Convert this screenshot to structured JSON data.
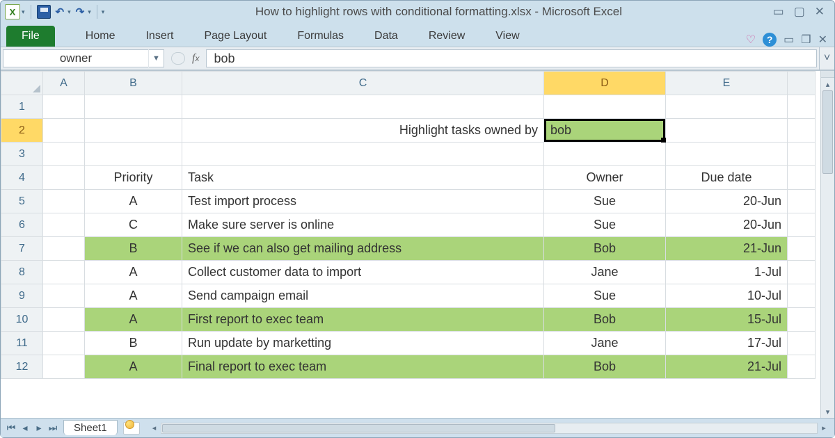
{
  "title": "How to highlight rows with conditional formatting.xlsx - Microsoft Excel",
  "tabs": {
    "file": "File",
    "home": "Home",
    "insert": "Insert",
    "page": "Page Layout",
    "formulas": "Formulas",
    "data": "Data",
    "review": "Review",
    "view": "View"
  },
  "namebox": "owner",
  "formula": "bob",
  "columns": [
    "A",
    "B",
    "C",
    "D",
    "E"
  ],
  "prompt_label": "Highlight tasks owned by",
  "prompt_value": "bob",
  "headers": {
    "priority": "Priority",
    "task": "Task",
    "owner": "Owner",
    "due": "Due date"
  },
  "rows": [
    {
      "p": "A",
      "t": "Test import process",
      "o": "Sue",
      "d": "20-Jun",
      "hl": false
    },
    {
      "p": "C",
      "t": "Make sure server is online",
      "o": "Sue",
      "d": "20-Jun",
      "hl": false
    },
    {
      "p": "B",
      "t": "See if we can also get mailing address",
      "o": "Bob",
      "d": "21-Jun",
      "hl": true
    },
    {
      "p": "A",
      "t": "Collect customer data to import",
      "o": "Jane",
      "d": "1-Jul",
      "hl": false
    },
    {
      "p": "A",
      "t": "Send campaign email",
      "o": "Sue",
      "d": "10-Jul",
      "hl": false
    },
    {
      "p": "A",
      "t": "First report to exec team",
      "o": "Bob",
      "d": "15-Jul",
      "hl": true
    },
    {
      "p": "B",
      "t": "Run update by marketting",
      "o": "Jane",
      "d": "17-Jul",
      "hl": false
    },
    {
      "p": "A",
      "t": "Final report to exec team",
      "o": "Bob",
      "d": "21-Jul",
      "hl": true
    }
  ],
  "sheet_tab": "Sheet1",
  "glyph": {
    "heart": "♡",
    "min": "▭",
    "max": "▢",
    "close": "✕",
    "down": "▾",
    "up": "▴",
    "left": "◂",
    "right": "▸",
    "first": "⏮",
    "last": "⏭",
    "undo": "↶",
    "redo": "↷",
    "sep": "▾"
  }
}
